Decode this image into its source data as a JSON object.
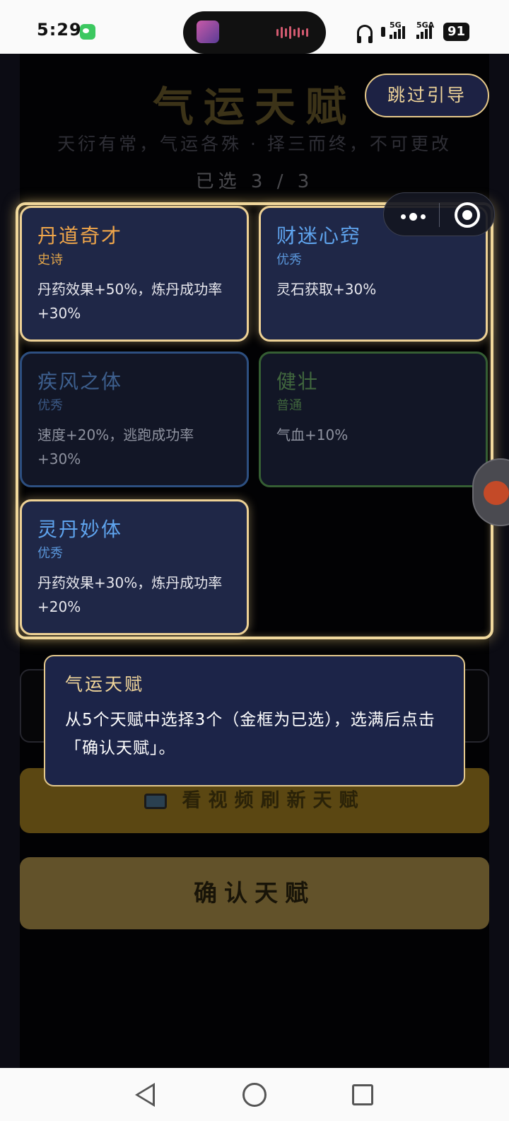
{
  "status_bar": {
    "time": "5:29",
    "network_1": "5G",
    "network_2": "5GA",
    "battery": "91"
  },
  "header": {
    "title": "气运天赋",
    "subtitle": "天衍有常，气运各殊 · 择三而终，不可更改",
    "counter": "已选 3 / 3",
    "skip_label": "跳过引导"
  },
  "talents": [
    {
      "name": "丹道奇才",
      "rarity": "史诗",
      "desc": "丹药效果+50%，炼丹成功率+30%",
      "selected": true,
      "name_color": "#f0a64a",
      "rarity_color": "#e0a44a"
    },
    {
      "name": "财迷心窍",
      "rarity": "优秀",
      "desc": "灵石获取+30%",
      "selected": true,
      "name_color": "#5fa4ee",
      "rarity_color": "#5a96da"
    },
    {
      "name": "疾风之体",
      "rarity": "优秀",
      "desc": "速度+20%，逃跑成功率+30%",
      "selected": false,
      "name_color": "#3d5f8e",
      "rarity_color": "#3a5884",
      "border_color": "#2d4f80"
    },
    {
      "name": "健壮",
      "rarity": "普通",
      "desc": "气血+10%",
      "selected": false,
      "name_color": "#41683e",
      "rarity_color": "#3f653c",
      "border_color": "#355e33"
    },
    {
      "name": "灵丹妙体",
      "rarity": "优秀",
      "desc": "丹药效果+30%，炼丹成功率+20%",
      "selected": true,
      "name_color": "#5fa4ee",
      "rarity_color": "#5a96da"
    }
  ],
  "tooltip": {
    "title": "气运天赋",
    "body": "从5个天赋中选择3个（金框为已选），选满后点击「确认天赋」。"
  },
  "buttons": {
    "refresh_label": "看视频刷新天赋",
    "confirm_label": "确认天赋"
  },
  "colors": {
    "gold_border": "#edd195",
    "card_selected_bg": "#1f2747",
    "confirm_bg": "#62522a"
  }
}
